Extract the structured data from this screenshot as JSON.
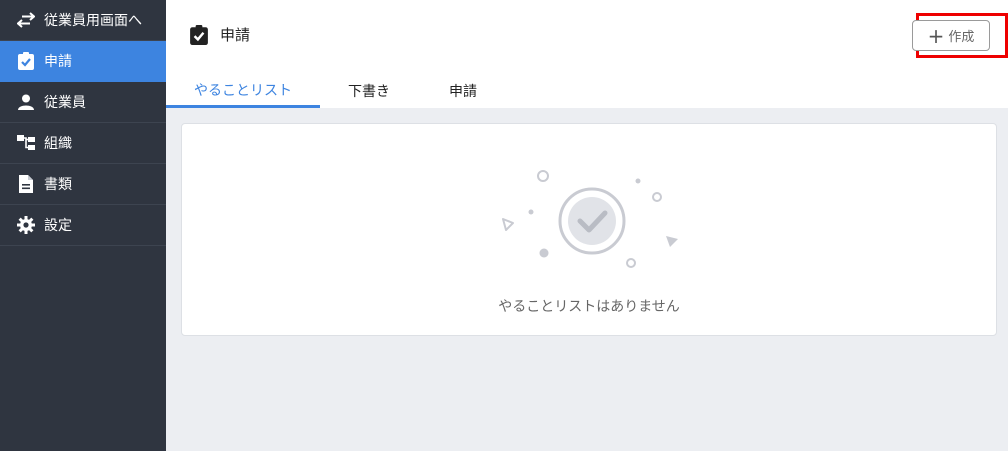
{
  "sidebar": {
    "items": [
      {
        "label": "従業員用画面へ",
        "icon": "swap-icon",
        "active": false
      },
      {
        "label": "申請",
        "icon": "clipboard-check-icon",
        "active": true
      },
      {
        "label": "従業員",
        "icon": "person-icon",
        "active": false
      },
      {
        "label": "組織",
        "icon": "org-chart-icon",
        "active": false
      },
      {
        "label": "書類",
        "icon": "document-icon",
        "active": false
      },
      {
        "label": "設定",
        "icon": "gear-icon",
        "active": false
      }
    ]
  },
  "header": {
    "title": "申請",
    "title_icon": "clipboard-check-icon",
    "create_button": {
      "label": "作成",
      "icon": "plus-icon"
    }
  },
  "tabs": [
    {
      "label": "やることリスト",
      "active": true
    },
    {
      "label": "下書き",
      "active": false
    },
    {
      "label": "申請",
      "active": false
    }
  ],
  "empty_state": {
    "icon": "check-circle-icon",
    "message": "やることリストはありません"
  },
  "colors": {
    "sidebar_bg": "#2f3540",
    "accent": "#3d84e0",
    "content_bg": "#eceef2",
    "highlight": "#ee0000"
  }
}
